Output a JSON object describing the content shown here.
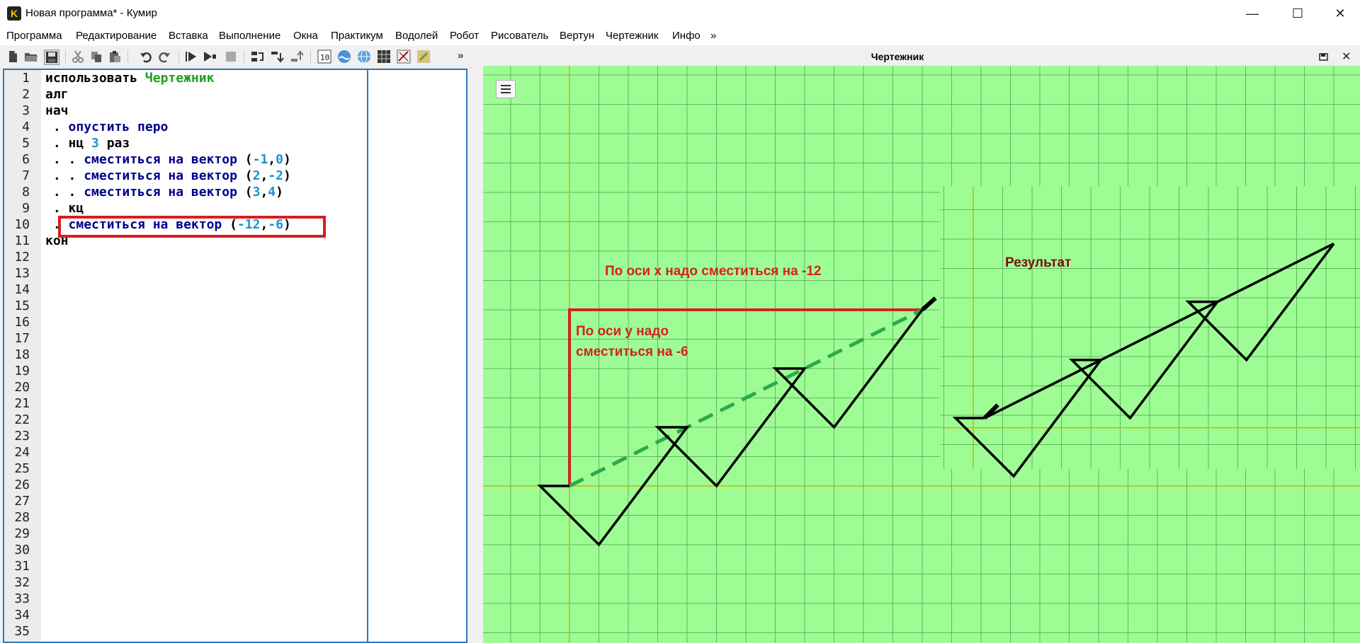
{
  "window": {
    "title": "Новая программа* - Кумир",
    "app_icon_letter": "K",
    "controls": {
      "minimize": "—",
      "maximize": "☐",
      "close": "✕"
    }
  },
  "menu": [
    "Программа",
    "Редактирование",
    "Вставка",
    "Выполнение",
    "Окна",
    "Практикум",
    "Водолей",
    "Робот",
    "Рисователь",
    "Вертун",
    "Чертежник",
    "Инфо",
    "»"
  ],
  "toolbar": {
    "overflow": "»",
    "icons": [
      "new-file-icon",
      "open-folder-icon",
      "save-icon",
      "cut-icon",
      "copy-icon",
      "paste-icon",
      "undo-icon",
      "redo-icon",
      "run-icon",
      "run-step-icon",
      "stop-icon",
      "step-over-icon",
      "step-into-icon",
      "step-out-icon",
      "counter-icon",
      "water-icon",
      "globe-icon",
      "grid-icon",
      "turtle-icon",
      "brush-icon"
    ]
  },
  "editor": {
    "line_numbers": [
      "1",
      "2",
      "3",
      "4",
      "5",
      "6",
      "7",
      "8",
      "9",
      "10",
      "11",
      "12",
      "13",
      "14",
      "15",
      "16",
      "17",
      "18",
      "19",
      "20",
      "21",
      "22",
      "23",
      "24",
      "25",
      "26",
      "27",
      "28",
      "29",
      "30",
      "31",
      "32",
      "33",
      "34",
      "35"
    ],
    "lines": [
      [
        {
          "t": "использовать ",
          "c": "kw"
        },
        {
          "t": "Чертежник",
          "c": "mod"
        }
      ],
      [
        {
          "t": "алг",
          "c": "kw"
        }
      ],
      [
        {
          "t": "нач",
          "c": "kw"
        }
      ],
      [
        {
          "t": " . ",
          "c": "kw"
        },
        {
          "t": "опустить перо",
          "c": "cmd"
        }
      ],
      [
        {
          "t": " . ",
          "c": "kw"
        },
        {
          "t": "нц ",
          "c": "kw"
        },
        {
          "t": "3",
          "c": "num"
        },
        {
          "t": " раз",
          "c": "kw"
        }
      ],
      [
        {
          "t": " . . ",
          "c": "kw"
        },
        {
          "t": "сместиться на вектор ",
          "c": "cmd"
        },
        {
          "t": "(",
          "c": "kw"
        },
        {
          "t": "-1",
          "c": "num"
        },
        {
          "t": ",",
          "c": "kw"
        },
        {
          "t": "0",
          "c": "num"
        },
        {
          "t": ")",
          "c": "kw"
        }
      ],
      [
        {
          "t": " . . ",
          "c": "kw"
        },
        {
          "t": "сместиться на вектор ",
          "c": "cmd"
        },
        {
          "t": "(",
          "c": "kw"
        },
        {
          "t": "2",
          "c": "num"
        },
        {
          "t": ",",
          "c": "kw"
        },
        {
          "t": "-2",
          "c": "num"
        },
        {
          "t": ")",
          "c": "kw"
        }
      ],
      [
        {
          "t": " . . ",
          "c": "kw"
        },
        {
          "t": "сместиться на вектор ",
          "c": "cmd"
        },
        {
          "t": "(",
          "c": "kw"
        },
        {
          "t": "3",
          "c": "num"
        },
        {
          "t": ",",
          "c": "kw"
        },
        {
          "t": "4",
          "c": "num"
        },
        {
          "t": ")",
          "c": "kw"
        }
      ],
      [
        {
          "t": " . ",
          "c": "kw"
        },
        {
          "t": "кц",
          "c": "kw"
        }
      ],
      [
        {
          "t": " . ",
          "c": "kw"
        },
        {
          "t": "сместиться на вектор ",
          "c": "cmd"
        },
        {
          "t": "(",
          "c": "kw"
        },
        {
          "t": "-12",
          "c": "num"
        },
        {
          "t": ",",
          "c": "kw"
        },
        {
          "t": "-6",
          "c": "num"
        },
        {
          "t": ")",
          "c": "kw"
        }
      ],
      [
        {
          "t": "кон",
          "c": "kw"
        }
      ]
    ],
    "highlighted_line": 10
  },
  "drawer_panel": {
    "title": "Чертежник",
    "annotation_x": "По оси х надо сместиться на -12",
    "annotation_y_line1": "По оси у надо",
    "annotation_y_line2": "сместиться на -6",
    "result_label": "Результат",
    "colors": {
      "background": "#9efc95",
      "grid": "#5fb85a",
      "axis": "#c8b400",
      "pen": "#000000",
      "annotation": "#d42020",
      "vector": "#2ea84a"
    }
  }
}
